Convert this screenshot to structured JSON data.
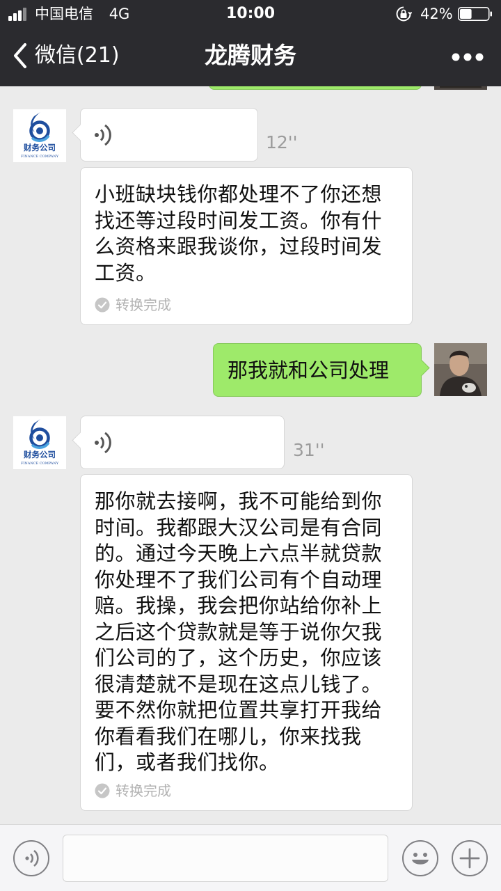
{
  "status_bar": {
    "carrier": "中国电信",
    "network": "4G",
    "time": "10:00",
    "battery_percent": "42%",
    "battery_level": 0.42
  },
  "nav": {
    "back_label": "微信(21)",
    "title": "龙腾财务"
  },
  "company_avatar_text": {
    "name": "财务公司",
    "subtitle": "FINANCE COMPANY"
  },
  "messages": [
    {
      "side": "left",
      "type": "voice",
      "duration": "12''",
      "transcript": "小班缺块钱你都处理不了你还想找还等过段时间发工资。你有什么资格来跟我谈你，过段时间发工资。",
      "converted_label": "转换完成"
    },
    {
      "side": "right",
      "type": "text",
      "text": "那我就和公司处理"
    },
    {
      "side": "left",
      "type": "voice",
      "duration": "31''",
      "transcript": "那你就去接啊，我不可能给到你时间。我都跟大汉公司是有合同的。通过今天晚上六点半就贷款你处理不了我们公司有个自动理赔。我操，我会把你站给你补上之后这个贷款就是等于说你欠我们公司的了，这个历史，你应该很清楚就不是现在这点儿钱了。要不然你就把位置共享打开我给你看看我们在哪儿，你来找我们，或者我们找你。",
      "converted_label": "转换完成"
    }
  ],
  "input": {
    "value": "",
    "placeholder": ""
  },
  "colors": {
    "nav_bg": "#2b2b2f",
    "chat_bg": "#ebebeb",
    "sent_bubble": "#9eea6a",
    "received_bubble": "#ffffff",
    "logo_blue": "#1f4e9e"
  },
  "icons": {
    "back": "chevron-left-icon",
    "more": "more-dots-icon",
    "voice": "voice-waves-icon",
    "converted": "check-circle-icon",
    "voice_mode": "voice-mode-icon",
    "emoji": "emoji-icon",
    "add": "plus-icon"
  }
}
